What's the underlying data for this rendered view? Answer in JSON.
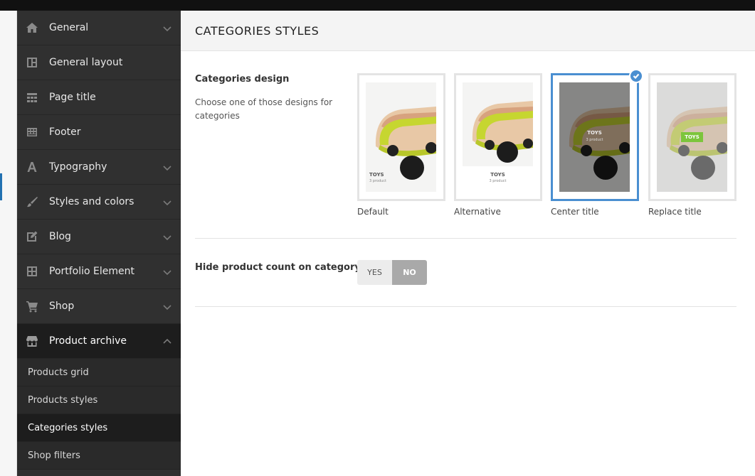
{
  "sidebar": {
    "items": [
      {
        "label": "General",
        "icon": "home-icon",
        "chevron": "down"
      },
      {
        "label": "General layout",
        "icon": "layout-icon",
        "chevron": "none"
      },
      {
        "label": "Page title",
        "icon": "page-title-icon",
        "chevron": "none"
      },
      {
        "label": "Footer",
        "icon": "footer-icon",
        "chevron": "none"
      },
      {
        "label": "Typography",
        "icon": "typography-icon",
        "chevron": "down"
      },
      {
        "label": "Styles and colors",
        "icon": "brush-icon",
        "chevron": "down"
      },
      {
        "label": "Blog",
        "icon": "edit-icon",
        "chevron": "down"
      },
      {
        "label": "Portfolio Element",
        "icon": "grid-icon",
        "chevron": "down"
      },
      {
        "label": "Shop",
        "icon": "cart-icon",
        "chevron": "down"
      },
      {
        "label": "Product archive",
        "icon": "store-icon",
        "chevron": "up"
      }
    ],
    "subitems": [
      {
        "label": "Products grid"
      },
      {
        "label": "Products styles"
      },
      {
        "label": "Categories styles"
      },
      {
        "label": "Shop filters"
      }
    ]
  },
  "main": {
    "title": "CATEGORIES STYLES",
    "design": {
      "title": "Categories design",
      "description": "Choose one of those designs for categories",
      "options": [
        {
          "caption": "Default",
          "toys": "TOYS",
          "count": "3 product"
        },
        {
          "caption": "Alternative",
          "toys": "TOYS",
          "count": "3 product"
        },
        {
          "caption": "Center title",
          "toys": "TOYS",
          "count": "3 product"
        },
        {
          "caption": "Replace title",
          "toys": "TOYS",
          "count": ""
        }
      ],
      "selected": "Center title"
    },
    "product_count": {
      "title": "Hide product count on category",
      "yes": "YES",
      "no": "NO",
      "value": "NO"
    }
  },
  "colors": {
    "accent": "#4a8fd1",
    "sidebar_bg": "#303030",
    "sidebar_active": "#1d1d1d",
    "toy_green": "#c6d630",
    "badge_green": "#7cc53c"
  }
}
